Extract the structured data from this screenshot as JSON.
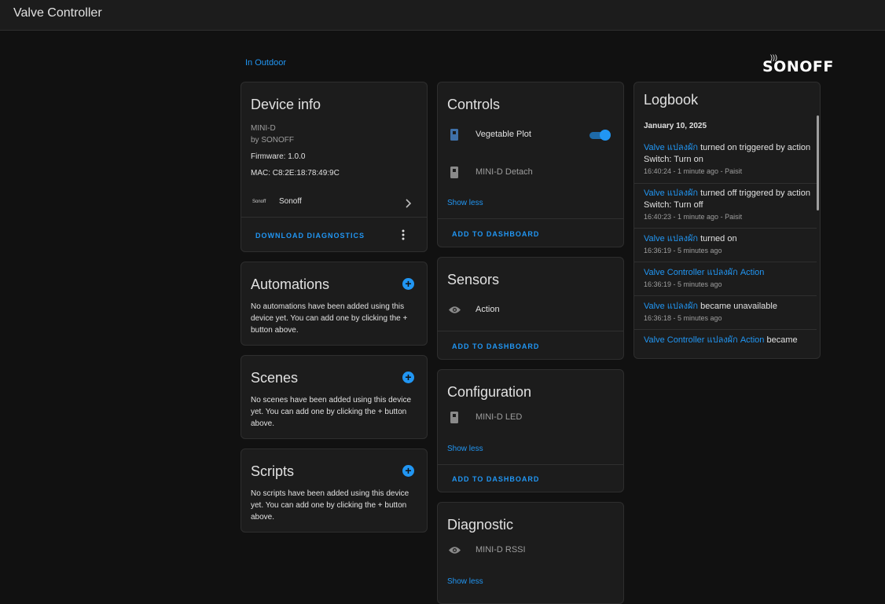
{
  "app": {
    "title": "Valve Controller"
  },
  "area_link": "In Outdoor",
  "brand": {
    "name": "SONOFF"
  },
  "device_info": {
    "title": "Device info",
    "model": "MINI-D",
    "by": "by SONOFF",
    "firmware": "Firmware: 1.0.0",
    "mac": "MAC: C8:2E:18:78:49:9C",
    "integration": "Sonoff",
    "integration_logo_text": "Sonoff",
    "download_label": "DOWNLOAD DIAGNOSTICS"
  },
  "automations": {
    "title": "Automations",
    "text": "No automations have been added using this device yet. You can add one by clicking the + button above."
  },
  "scenes": {
    "title": "Scenes",
    "text": "No scenes have been added using this device yet. You can add one by clicking the + button above."
  },
  "scripts": {
    "title": "Scripts",
    "text": "No scripts have been added using this device yet. You can add one by clicking the + button above."
  },
  "controls": {
    "title": "Controls",
    "items": [
      {
        "label": "Vegetable Plot",
        "icon": "valve-icon",
        "toggle_on": true
      },
      {
        "label": "MINI-D Detach",
        "icon": "switch-icon"
      }
    ],
    "show_less": "Show less",
    "add_label": "ADD TO DASHBOARD"
  },
  "sensors": {
    "title": "Sensors",
    "items": [
      {
        "label": "Action",
        "icon": "eye-icon"
      }
    ],
    "add_label": "ADD TO DASHBOARD"
  },
  "configuration": {
    "title": "Configuration",
    "items": [
      {
        "label": "MINI-D LED",
        "icon": "switch-icon"
      }
    ],
    "show_less": "Show less",
    "add_label": "ADD TO DASHBOARD"
  },
  "diagnostic": {
    "title": "Diagnostic",
    "items": [
      {
        "label": "MINI-D RSSI",
        "icon": "eye-icon"
      }
    ],
    "show_less": "Show less"
  },
  "logbook": {
    "title": "Logbook",
    "date": "January 10, 2025",
    "entries": [
      {
        "name": "Valve แปลงผัก",
        "msg": " turned on triggered by action Switch: Turn on",
        "meta": "16:40:24 - 1 minute ago - Paisit"
      },
      {
        "name": "Valve แปลงผัก",
        "msg": " turned off triggered by action Switch: Turn off",
        "meta": "16:40:23 - 1 minute ago - Paisit"
      },
      {
        "name": "Valve แปลงผัก",
        "msg": " turned on",
        "meta": "16:36:19 - 5 minutes ago"
      },
      {
        "name": "Valve Controller แปลงผัก Action",
        "msg": "",
        "meta": "16:36:19 - 5 minutes ago"
      },
      {
        "name": "Valve แปลงผัก",
        "msg": " became unavailable",
        "meta": "16:36:18 - 5 minutes ago"
      },
      {
        "name": "Valve Controller แปลงผัก Action",
        "msg": " became",
        "meta": ""
      }
    ]
  },
  "colors": {
    "accent": "#2196f3",
    "background": "#111111",
    "card": "#1c1c1c"
  }
}
